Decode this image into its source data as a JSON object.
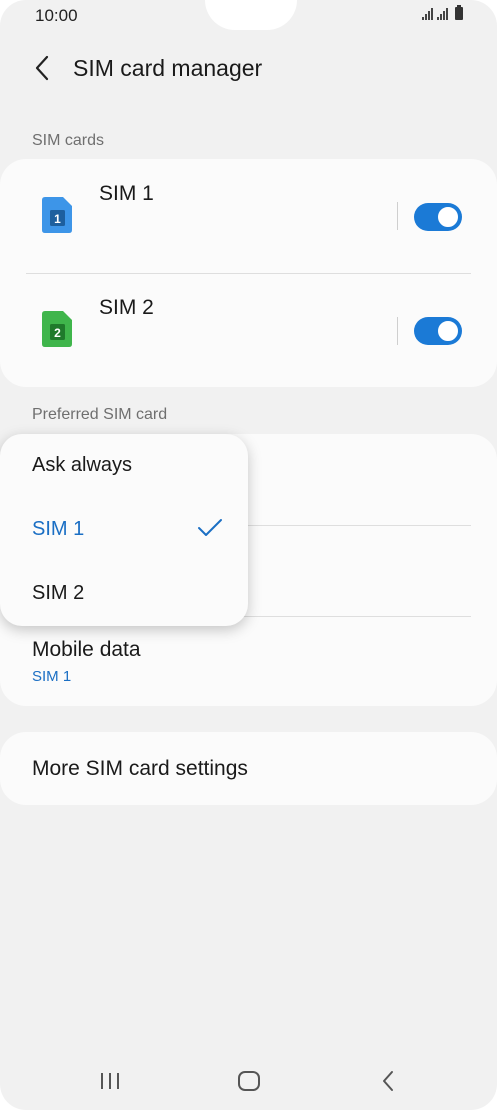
{
  "status_bar": {
    "time": "10:00"
  },
  "header": {
    "title": "SIM card manager"
  },
  "sim_cards": {
    "label": "SIM cards",
    "items": [
      {
        "name": "SIM 1",
        "icon_number": "1",
        "icon_color": "#3d95e8",
        "enabled": true
      },
      {
        "name": "SIM 2",
        "icon_number": "2",
        "icon_color": "#3fb54b",
        "enabled": true
      }
    ]
  },
  "preferred": {
    "label": "Preferred SIM card",
    "mobile_data": {
      "title": "Mobile data",
      "value": "SIM 1"
    }
  },
  "dropdown": {
    "options": [
      {
        "label": "Ask always",
        "selected": false
      },
      {
        "label": "SIM 1",
        "selected": true
      },
      {
        "label": "SIM 2",
        "selected": false
      }
    ]
  },
  "more_settings": {
    "label": "More SIM card settings"
  },
  "colors": {
    "accent": "#1b7ad6",
    "background": "#f1f1f1",
    "card": "#fbfbfb"
  }
}
